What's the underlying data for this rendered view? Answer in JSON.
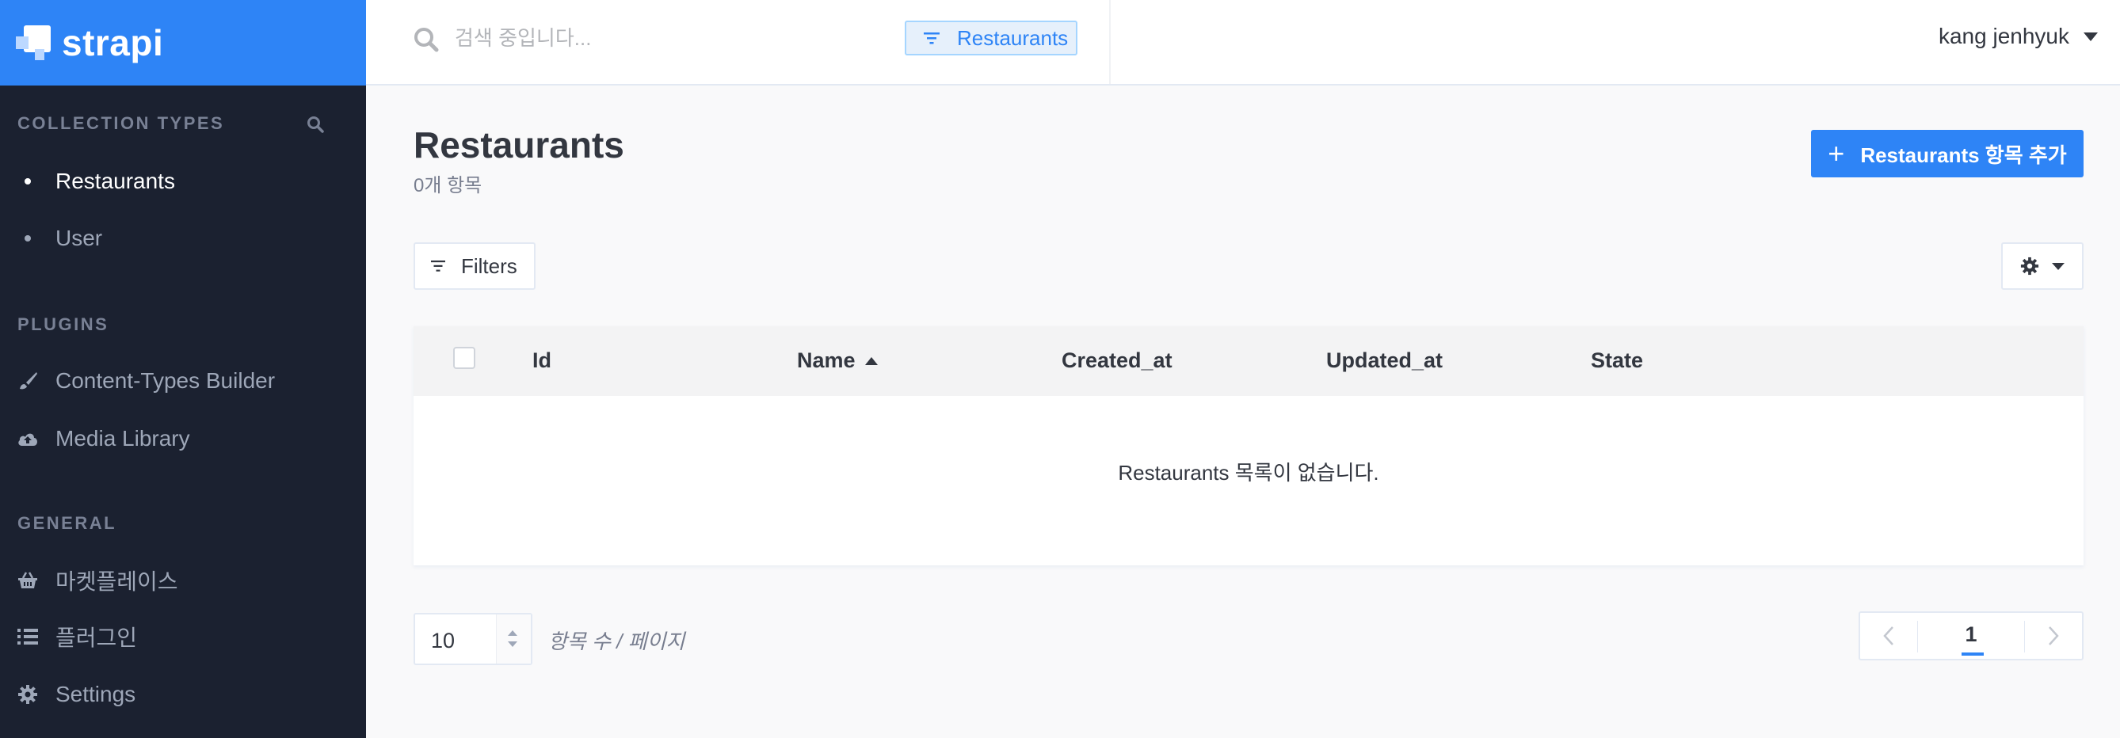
{
  "brand": {
    "name": "strapi"
  },
  "sidebar": {
    "collection_types": {
      "title": "COLLECTION TYPES",
      "items": [
        {
          "label": "Restaurants",
          "active": true
        },
        {
          "label": "User",
          "active": false
        }
      ]
    },
    "plugins": {
      "title": "PLUGINS",
      "items": [
        {
          "label": "Content-Types Builder",
          "icon": "paint-brush-icon"
        },
        {
          "label": "Media Library",
          "icon": "cloud-upload-icon"
        }
      ]
    },
    "general": {
      "title": "GENERAL",
      "items": [
        {
          "label": "마켓플레이스",
          "icon": "basket-icon"
        },
        {
          "label": "플러그인",
          "icon": "list-icon"
        },
        {
          "label": "Settings",
          "icon": "gear-icon"
        }
      ]
    }
  },
  "header": {
    "search": {
      "placeholder": "검색 중입니다...",
      "value": ""
    },
    "filter_tag": "Restaurants",
    "user_name": "kang jenhyuk"
  },
  "main": {
    "title": "Restaurants",
    "count": "0개 항목",
    "add_button": "Restaurants 항목 추가",
    "filters_label": "Filters",
    "table": {
      "columns": [
        "Id",
        "Name",
        "Created_at",
        "Updated_at",
        "State"
      ],
      "sorted_column": "Name",
      "sort_direction": "asc",
      "empty_message": "Restaurants 목록이 없습니다."
    },
    "per_page": {
      "value": "10",
      "label": "항목 수 / 페이지"
    },
    "pagination": {
      "current_page": "1"
    }
  },
  "colors": {
    "accent": "#2e84f6",
    "sidebar_bg": "#1b2130",
    "sidebar_text": "#9ea7b8"
  }
}
